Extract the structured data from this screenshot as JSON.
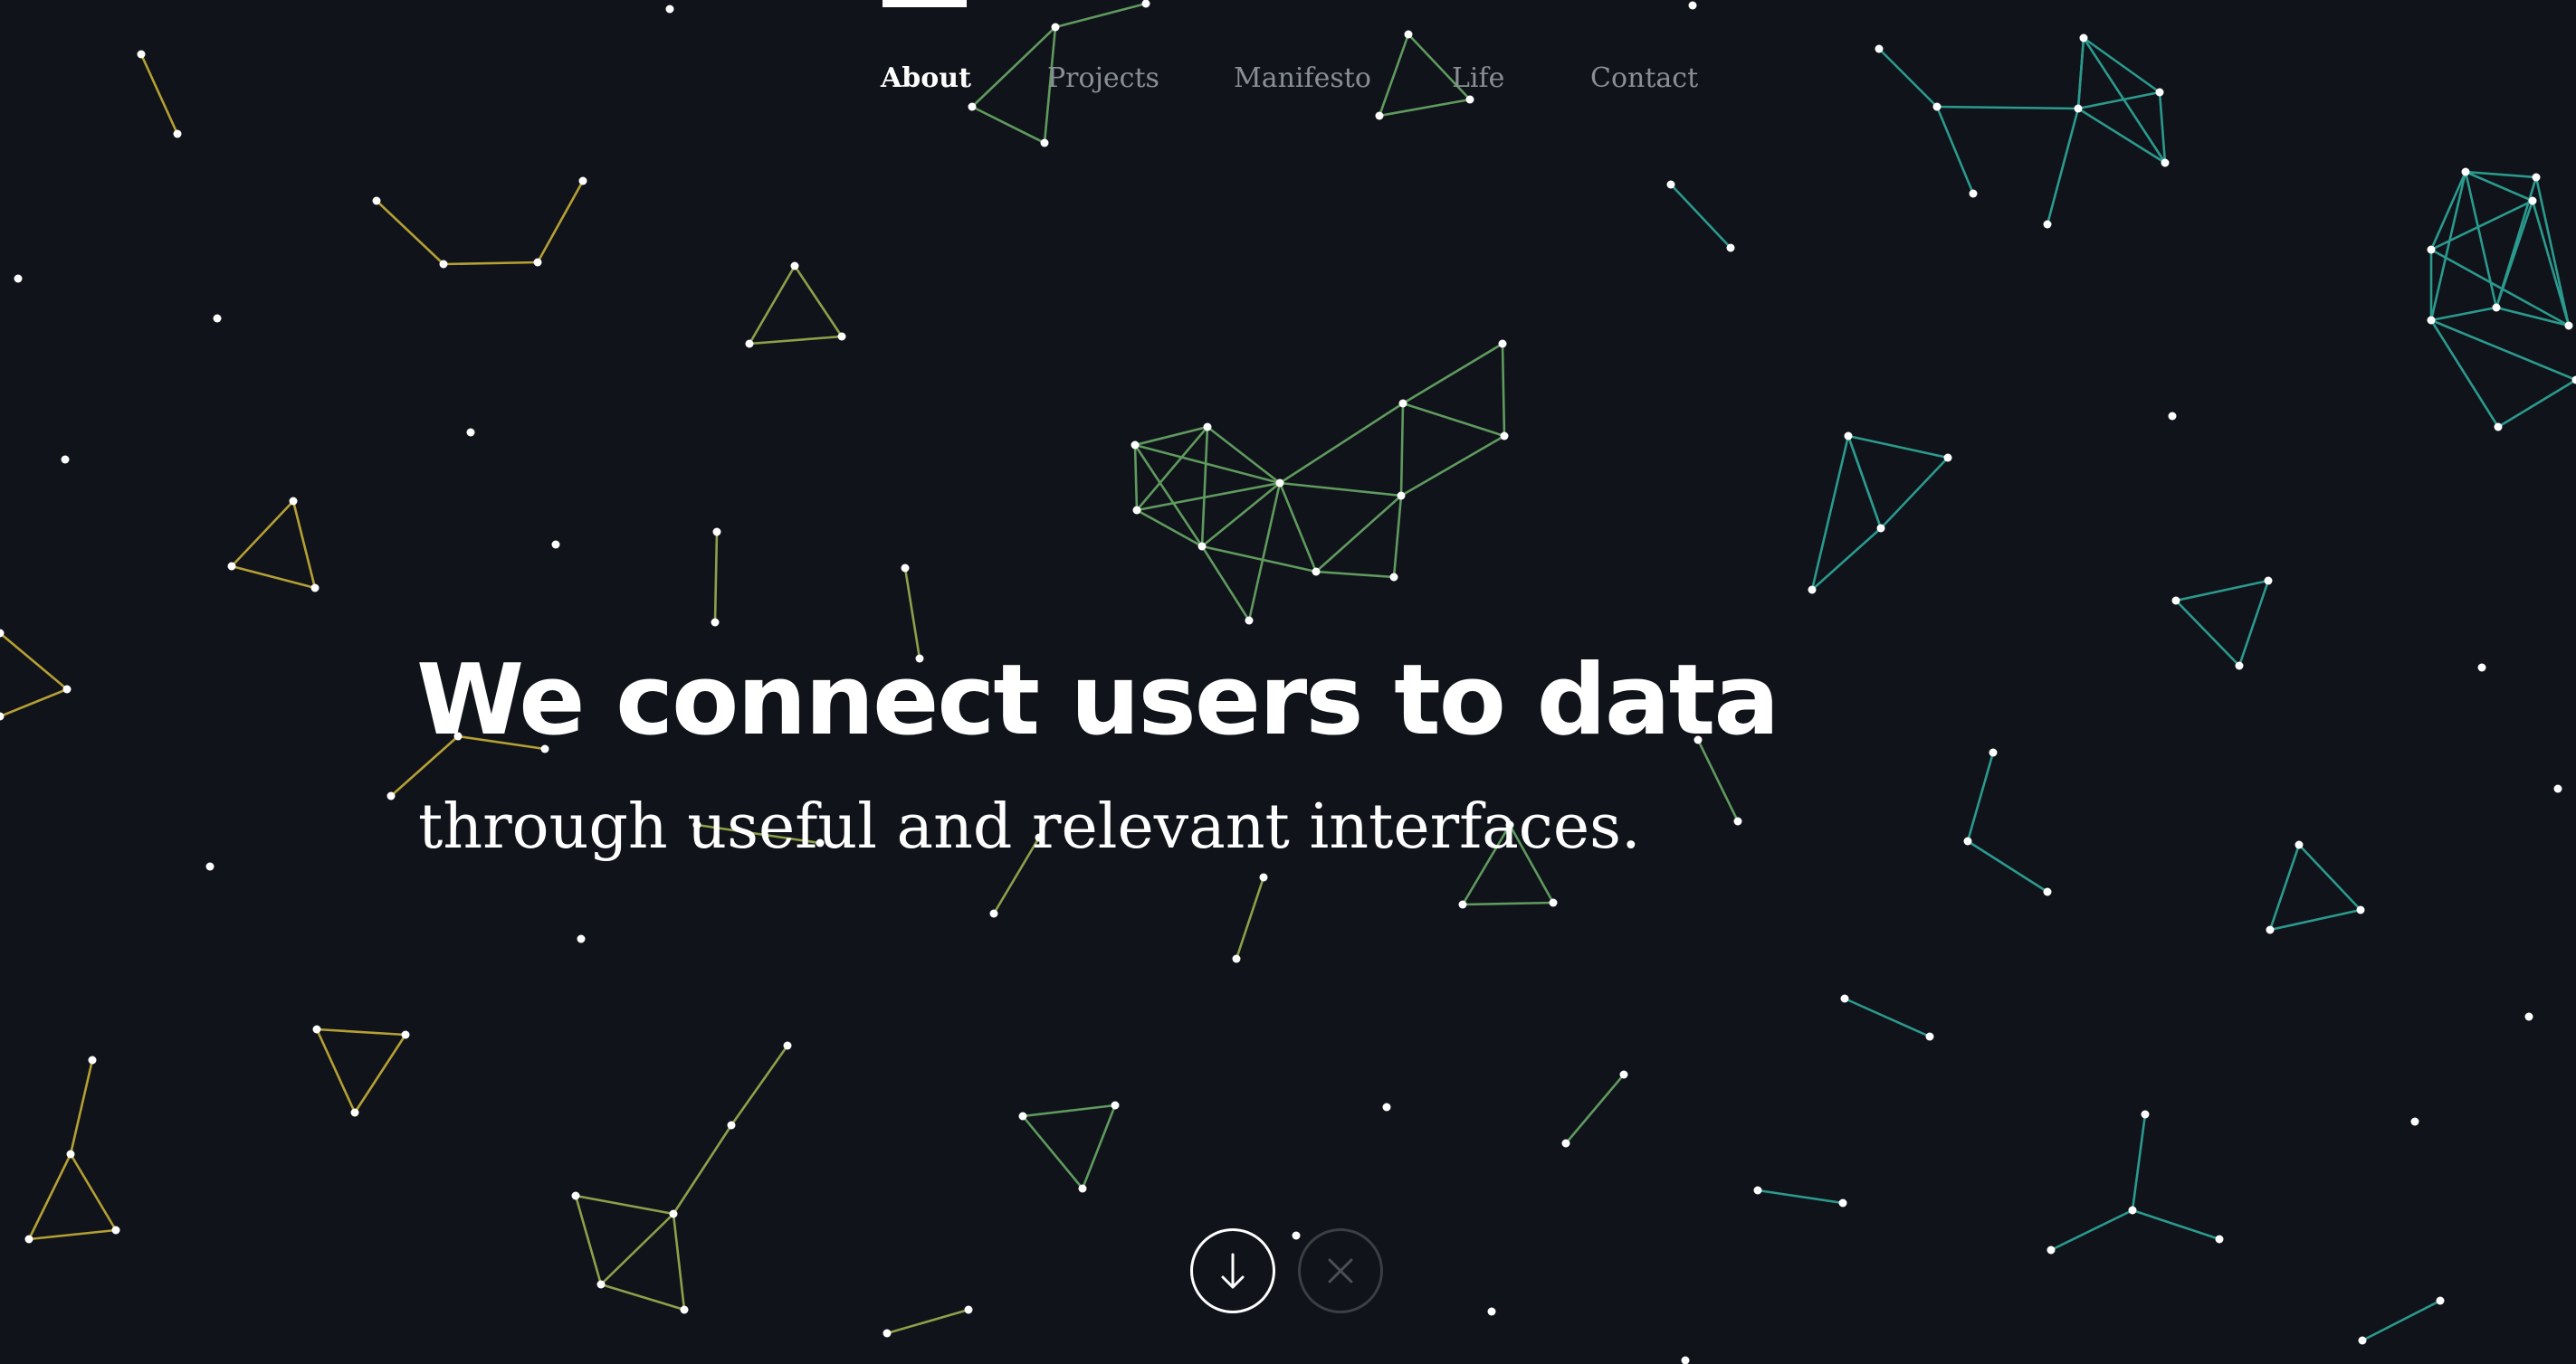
{
  "nav": {
    "items": [
      {
        "label": "About",
        "active": true
      },
      {
        "label": "Projects",
        "active": false
      },
      {
        "label": "Manifesto",
        "active": false
      },
      {
        "label": "Life",
        "active": false
      },
      {
        "label": "Contact",
        "active": false
      }
    ]
  },
  "hero": {
    "title": "We connect users to data",
    "subtitle": "through useful and relevant interfaces."
  },
  "controls": {
    "scroll_down_icon": "arrow-down-icon",
    "close_icon": "close-icon"
  },
  "colors": {
    "background": "#10131a",
    "yellow": "#b5a034",
    "olive": "#8ea04a",
    "green": "#5f9a5e",
    "teal": "#2b9a8e"
  }
}
